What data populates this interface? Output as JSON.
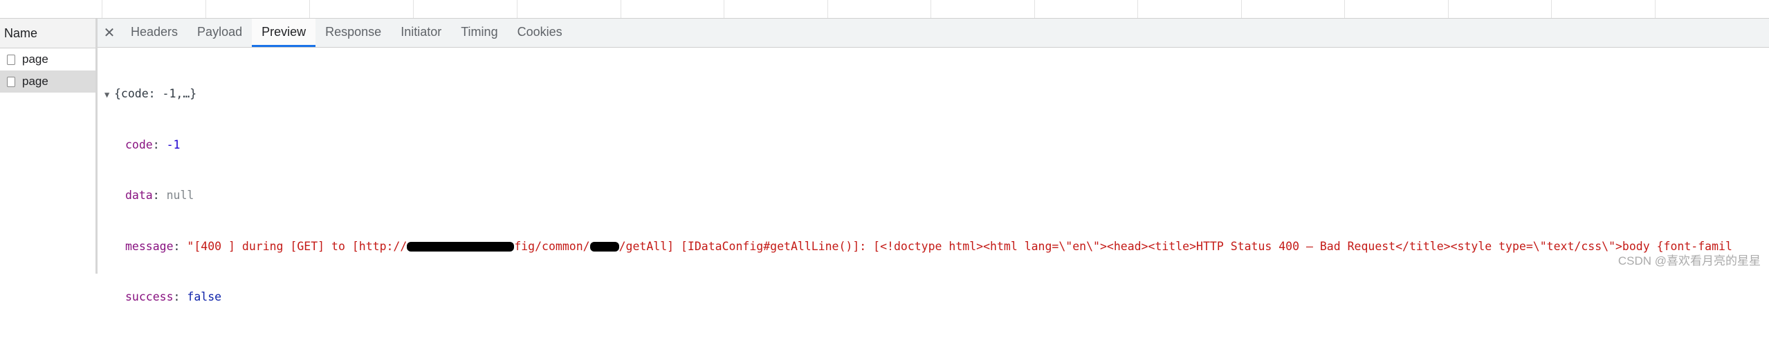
{
  "left_panel": {
    "header": "Name",
    "requests": [
      {
        "name": "page",
        "selected": false
      },
      {
        "name": "page",
        "selected": true
      }
    ]
  },
  "tabs": {
    "close_glyph": "✕",
    "items": [
      "Headers",
      "Payload",
      "Preview",
      "Response",
      "Initiator",
      "Timing",
      "Cookies"
    ],
    "active": "Preview"
  },
  "preview": {
    "summary": "{code: -1,…}",
    "fields": {
      "code_key": "code",
      "code_value": "-1",
      "data_key": "data",
      "data_value": "null",
      "message_key": "message",
      "message_part1": "\"[400 ] during [GET] to [http://",
      "message_part2": "fig/common/",
      "message_part3": "/getAll] [IDataConfig#getAllLine()]: [<!doctype html><html lang=\\\"en\\\"><head><title>HTTP Status 400 – Bad Request</title><style type=\\\"text/css\\\">body {font-famil",
      "success_key": "success",
      "success_value": "false"
    }
  },
  "watermark": "CSDN @喜欢看月亮的星星",
  "colors": {
    "active_tab_underline": "#1a73e8",
    "key": "#881280",
    "string": "#c41a16",
    "number": "#1c00cf",
    "boolean": "#0d22aa"
  }
}
